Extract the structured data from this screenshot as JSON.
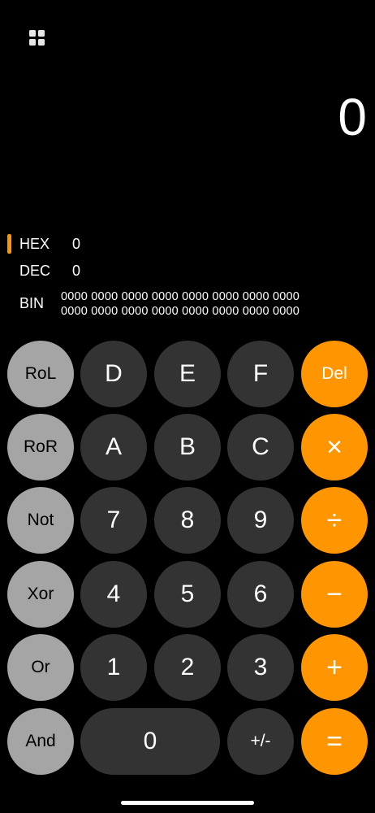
{
  "display": {
    "value": "0"
  },
  "bases": {
    "hex": {
      "label": "HEX",
      "value": "0"
    },
    "dec": {
      "label": "DEC",
      "value": "0"
    },
    "bin": {
      "label": "BIN",
      "line1": "0000 0000 0000 0000 0000 0000 0000 0000",
      "line2": "0000 0000 0000 0000 0000 0000 0000 0000"
    }
  },
  "keys": {
    "rol": "RoL",
    "d": "D",
    "e": "E",
    "f": "F",
    "del": "Del",
    "ror": "RoR",
    "a": "A",
    "b": "B",
    "c": "C",
    "multiply": "×",
    "not": "Not",
    "seven": "7",
    "eight": "8",
    "nine": "9",
    "divide": "÷",
    "xor": "Xor",
    "four": "4",
    "five": "5",
    "six": "6",
    "minus": "−",
    "or": "Or",
    "one": "1",
    "two": "2",
    "three": "3",
    "plus": "+",
    "and": "And",
    "zero": "0",
    "negate": "+/-",
    "equals": "="
  },
  "colors": {
    "operator": "#ff9500",
    "function": "#a5a5a5",
    "digit": "#333333",
    "background": "#000000"
  },
  "icons": {
    "menu": "grid-icon"
  }
}
